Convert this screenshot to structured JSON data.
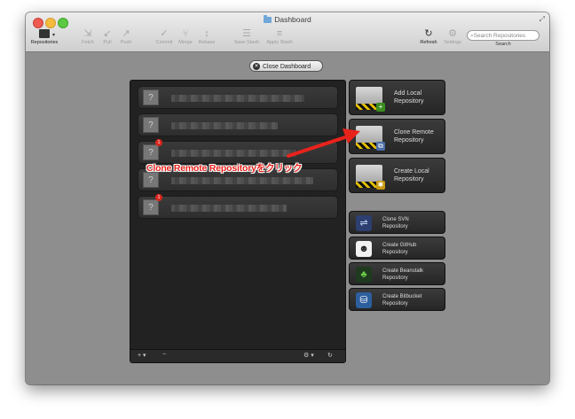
{
  "window": {
    "title": "Dashboard"
  },
  "toolbar": {
    "repositories": "Repositories",
    "fetch": "Fetch",
    "pull": "Pull",
    "push": "Push",
    "commit": "Commit",
    "merge": "Merge",
    "rebase": "Rebase",
    "save_stash": "Save Stash",
    "apply_stash": "Apply Stash",
    "refresh": "Refresh",
    "settings": "Settings",
    "search_placeholder": "Search Repositories",
    "search_label": "Search"
  },
  "close_dashboard": "Close Dashboard",
  "repo_list": {
    "rows": [
      {
        "thumb": "?",
        "badge": ""
      },
      {
        "thumb": "?",
        "badge": ""
      },
      {
        "thumb": "?",
        "badge": "1"
      },
      {
        "thumb": "?",
        "badge": ""
      },
      {
        "thumb": "?",
        "badge": "1"
      }
    ],
    "footer": {
      "add": "+ ▾",
      "remove": "−",
      "gear": "⚙ ▾",
      "refresh": "↻"
    }
  },
  "actions": {
    "add_local": "Add Local\nRepository",
    "clone_remote": "Clone Remote\nRepository",
    "create_local": "Create Local\nRepository",
    "clone_svn": "Clone SVN\nRepository",
    "create_github": "Create GitHub\nRepository",
    "create_beanstalk": "Create Beanstalk\nRepository",
    "create_bitbucket": "Create Bitbucket\nRepository"
  },
  "annotation": {
    "text": "Clone Remote Repositoryをクリック",
    "color": "#e8231c"
  }
}
